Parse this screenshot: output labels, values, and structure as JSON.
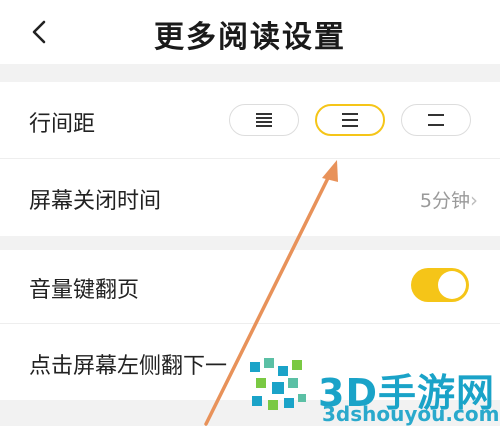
{
  "header": {
    "title": "更多阅读设置",
    "back_icon": "chevron-left-icon"
  },
  "line_spacing": {
    "label": "行间距",
    "options": [
      {
        "icon": "spacing-small-icon"
      },
      {
        "icon": "spacing-medium-icon",
        "selected": true
      },
      {
        "icon": "spacing-large-icon"
      }
    ]
  },
  "screen_off": {
    "label": "屏幕关闭时间",
    "value": "5分钟",
    "chevron_icon": "chevron-right-icon"
  },
  "volume_page": {
    "label": "音量键翻页",
    "enabled": true
  },
  "tap_left": {
    "label": "点击屏幕左侧翻下一"
  },
  "watermark": {
    "brand": "3D手游网",
    "url": "3dshouyou.com"
  },
  "colors": {
    "accent": "#f5c518",
    "annotation_arrow": "#e8925a"
  }
}
